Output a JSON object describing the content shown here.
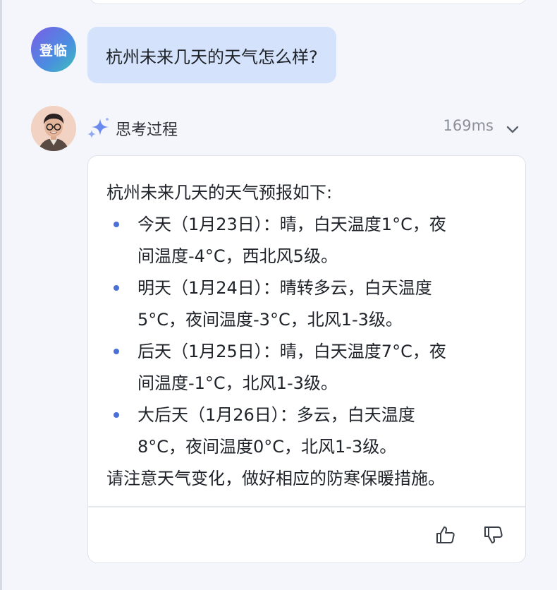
{
  "user": {
    "avatar_text": "登临",
    "message": "杭州未来几天的天气怎么样?"
  },
  "assistant": {
    "thinking_label": "思考过程",
    "thinking_time": "169ms",
    "answer": {
      "intro": "杭州未来几天的天气预报如下:",
      "items": [
        {
          "line1": "今天（1月23日）：晴，白天温度1°C，夜",
          "line2": "间温度-4°C，西北风5级。"
        },
        {
          "line1": "明天（1月24日）：晴转多云，白天温度",
          "line2": "5°C，夜间温度-3°C，北风1-3级。"
        },
        {
          "line1": "后天（1月25日）：晴，白天温度7°C，夜",
          "line2": "间温度-1°C，北风1-3级。"
        },
        {
          "line1": "大后天（1月26日）：多云，白天温度",
          "line2": "8°C，夜间温度0°C，北风1-3级。"
        }
      ],
      "outro": "请注意天气变化，做好相应的防寒保暖措施。"
    }
  },
  "icons": {
    "thinking": "sparkle-icon",
    "expand": "chevron-down-icon",
    "like": "thumbs-up-icon",
    "dislike": "thumbs-down-icon"
  },
  "colors": {
    "user_bubble": "#d4e3fb",
    "bullet": "#4a6fd6",
    "sparkle": "#6b8af0"
  }
}
